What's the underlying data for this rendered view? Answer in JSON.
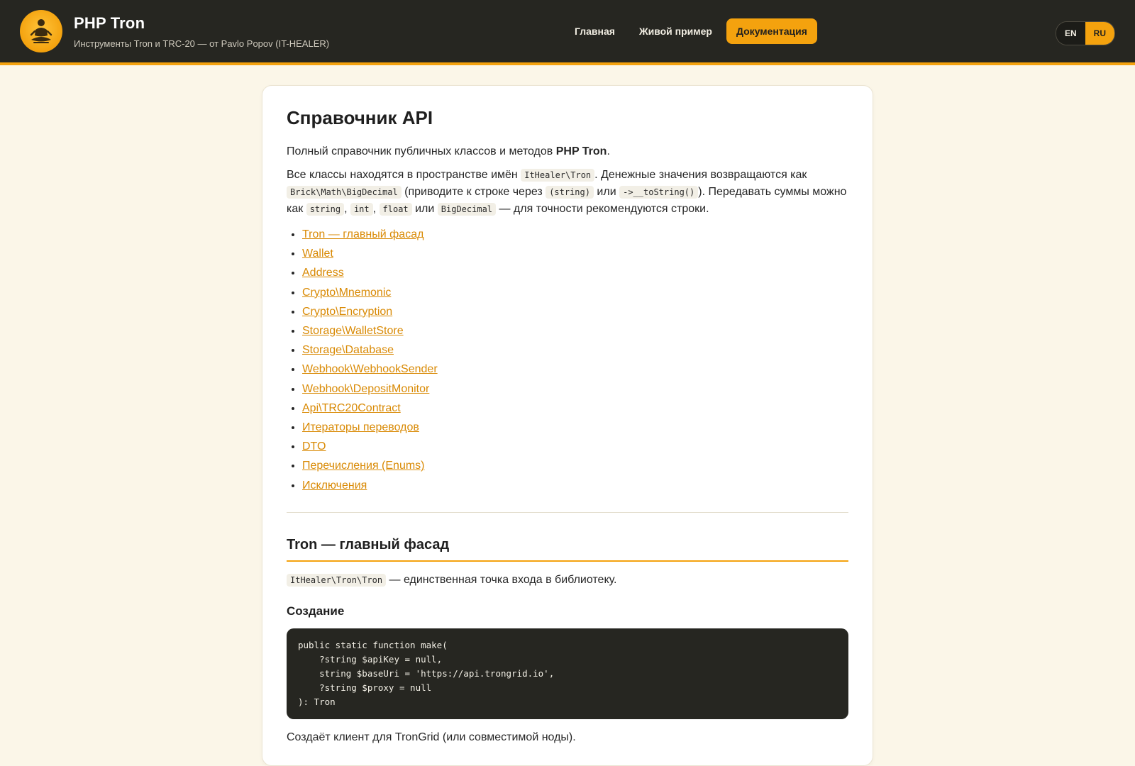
{
  "header": {
    "title": "PHP Tron",
    "subtitle": "Инструменты Tron и TRC-20 — от Pavlo Popov (IT-HEALER)",
    "nav": [
      {
        "label": "Главная",
        "active": false
      },
      {
        "label": "Живой пример",
        "active": false
      },
      {
        "label": "Документация",
        "active": true
      }
    ],
    "lang": [
      {
        "label": "EN",
        "active": false
      },
      {
        "label": "RU",
        "active": true
      }
    ]
  },
  "page": {
    "title": "Справочник API",
    "intro_prefix": "Полный справочник публичных классов и методов ",
    "intro_bold": "PHP Tron",
    "intro_suffix": ".",
    "ns": {
      "t1": "Все классы находятся в пространстве имён ",
      "c1": "ItHealer\\Tron",
      "t2": ". Денежные значения возвращаются как ",
      "c2": "Brick\\Math\\BigDecimal",
      "t3": " (приводите к строке через ",
      "c3": "(string)",
      "t4": " или ",
      "c4": "->__toString()",
      "t5": "). Передавать суммы можно как ",
      "c5": "string",
      "t6": ", ",
      "c6": "int",
      "t7": ", ",
      "c7": "float",
      "t8": " или ",
      "c8": "BigDecimal",
      "t9": " — для точности рекомендуются строки."
    },
    "toc": [
      "Tron — главный фасад",
      "Wallet",
      "Address",
      "Crypto\\Mnemonic",
      "Crypto\\Encryption",
      "Storage\\WalletStore",
      "Storage\\Database",
      "Webhook\\WebhookSender",
      "Webhook\\DepositMonitor",
      "Api\\TRC20Contract",
      "Итераторы переводов",
      "DTO",
      "Перечисления (Enums)",
      "Исключения"
    ],
    "section": {
      "title": "Tron — главный фасад",
      "desc_code": "ItHealer\\Tron\\Tron",
      "desc_text": " — единственная точка входа в библиотеку.",
      "sub_title": "Создание",
      "code": "public static function make(\n    ?string $apiKey = null,\n    string $baseUri = 'https://api.trongrid.io',\n    ?string $proxy = null\n): Tron",
      "after": "Создаёт клиент для TronGrid (или совместимой ноды)."
    }
  },
  "colors": {
    "accent": "#f4a20e",
    "header_bg": "#262621",
    "page_bg": "#fbf6e8",
    "link": "#d98a05"
  }
}
